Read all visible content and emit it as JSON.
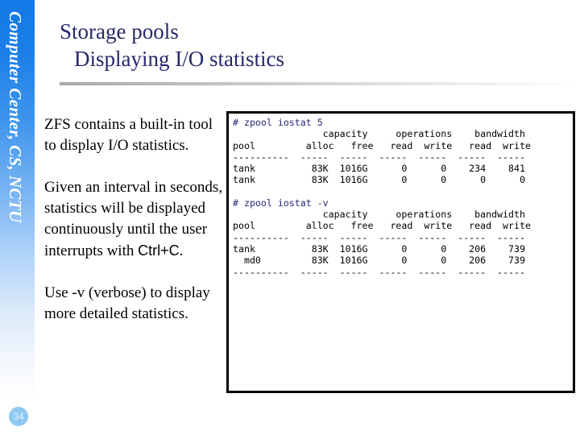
{
  "sidebar": {
    "vertical_label": "Computer Center, CS, NCTU",
    "page_number": "34",
    "badge_color": "#8ec9f2",
    "gradient_top_color": "#1479e6",
    "gradient_bottom_color": "#ffffff"
  },
  "title": {
    "line1": "Storage pools",
    "line2": "Displaying I/O statistics",
    "color": "#27286b",
    "rule_color": "#a9a9ab"
  },
  "body": {
    "paragraph1": "ZFS contains a built-in tool to display I/O statistics.",
    "paragraph2_part1": "Given an interval in seconds, statistics will be displayed continuously until the user interrupts with ",
    "paragraph2_keys": "Ctrl+C",
    "paragraph2_part2": ".",
    "paragraph3": "Use -v (verbose) to display more detailed statistics."
  },
  "terminal": {
    "border_color": "#000000",
    "background": "#ffffff",
    "command_color": "#262673",
    "block1": {
      "command": "# zpool iostat 5",
      "lines": [
        "                capacity     operations    bandwidth",
        "pool         alloc   free   read  write   read  write",
        "----------  -----  -----  -----  -----  -----  -----",
        "tank          83K  1016G      0      0    234    841",
        "tank          83K  1016G      0      0      0      0"
      ],
      "header_groups": [
        "capacity",
        "operations",
        "bandwidth"
      ],
      "columns": [
        "pool",
        "alloc",
        "free",
        "read",
        "write",
        "read",
        "write"
      ],
      "rows": [
        {
          "pool": "tank",
          "alloc": "83K",
          "free": "1016G",
          "ops_read": "0",
          "ops_write": "0",
          "bw_read": "234",
          "bw_write": "841"
        },
        {
          "pool": "tank",
          "alloc": "83K",
          "free": "1016G",
          "ops_read": "0",
          "ops_write": "0",
          "bw_read": "0",
          "bw_write": "0"
        }
      ]
    },
    "block2": {
      "command": "# zpool iostat -v",
      "lines": [
        "                capacity     operations    bandwidth",
        "pool         alloc   free   read  write   read  write",
        "----------  -----  -----  -----  -----  -----  -----",
        "tank          83K  1016G      0      0    206    739",
        "  md0         83K  1016G      0      0    206    739",
        "----------  -----  -----  -----  -----  -----  -----"
      ],
      "header_groups": [
        "capacity",
        "operations",
        "bandwidth"
      ],
      "columns": [
        "pool",
        "alloc",
        "free",
        "read",
        "write",
        "read",
        "write"
      ],
      "rows": [
        {
          "pool": "tank",
          "alloc": "83K",
          "free": "1016G",
          "ops_read": "0",
          "ops_write": "0",
          "bw_read": "206",
          "bw_write": "739"
        },
        {
          "pool": "  md0",
          "alloc": "83K",
          "free": "1016G",
          "ops_read": "0",
          "ops_write": "0",
          "bw_read": "206",
          "bw_write": "739"
        }
      ]
    }
  }
}
